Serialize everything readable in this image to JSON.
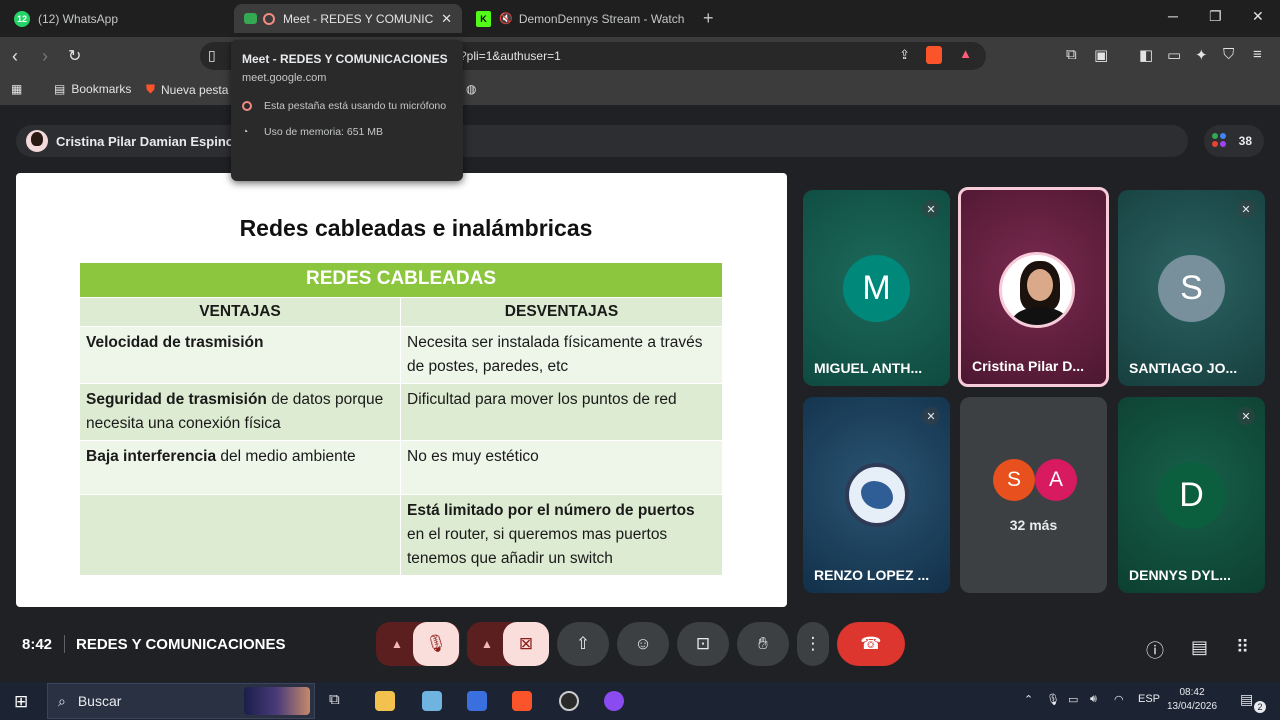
{
  "browser": {
    "tabs": [
      {
        "title": "(12) WhatsApp",
        "badge": "12"
      },
      {
        "title": "Meet - REDES Y COMUNICAC"
      },
      {
        "title": "DemonDennys Stream - Watch Li"
      }
    ],
    "new_tab_label": "+",
    "url_partial": "?pli=1&authuser=1",
    "bookmarks": [
      {
        "label": "Bookmarks"
      },
      {
        "label": "Nueva pesta"
      }
    ]
  },
  "tooltip": {
    "title": "Meet - REDES Y COMUNICACIONES",
    "domain": "meet.google.com",
    "mic_line": "Esta pestaña está usando tu micrófono",
    "memory_line": "Uso de memoria: 651 MB"
  },
  "meet": {
    "presenter_name": "Cristina Pilar Damian Espinoz",
    "people_count": "38",
    "slide": {
      "title": "Redes cableadas e inalámbricas",
      "table_title": "REDES CABLEADAS",
      "col_left": "VENTAJAS",
      "col_right": "DESVENTAJAS",
      "rows": [
        {
          "left_bold": "Velocidad de trasmisión",
          "left_rest": "",
          "right_bold": "",
          "right_rest": "Necesita ser instalada físicamente a través de postes, paredes, etc"
        },
        {
          "left_bold": "Seguridad de trasmisión",
          "left_rest": " de datos porque necesita una conexión física",
          "right_bold": "",
          "right_rest": "Dificultad para mover los puntos de red"
        },
        {
          "left_bold": "Baja interferencia",
          "left_rest": " del medio ambiente",
          "right_bold": "",
          "right_rest": "No es muy estético"
        },
        {
          "left_bold": "",
          "left_rest": "",
          "right_bold": "Está limitado por el número de puertos",
          "right_rest": " en el router, si queremos mas puertos tenemos que añadir un switch"
        }
      ]
    },
    "tiles": [
      {
        "name": "MIGUEL ANTH...",
        "initial": "M",
        "avatar_color": "#00897b",
        "bg": "#0f5147"
      },
      {
        "name": "Cristina Pilar D...",
        "bg": "#5b1c3a"
      },
      {
        "name": "SANTIAGO JO...",
        "initial": "S",
        "avatar_color": "#78909c",
        "bg": "#1d4b4a"
      },
      {
        "name": "RENZO LOPEZ ...",
        "bg": "#17384a"
      },
      {
        "more": "32 más",
        "a1": "S",
        "a1_color": "#e8501e",
        "a2": "A",
        "a2_color": "#d81b60",
        "bg": "#3c4043"
      },
      {
        "name": "DENNYS DYL...",
        "initial": "D",
        "avatar_color": "#0b5e3e",
        "bg": "#0f4a37"
      }
    ],
    "clock": "8:42",
    "meeting_title": "REDES Y COMUNICACIONES"
  },
  "taskbar": {
    "search_placeholder": "Buscar",
    "lang": "ESP",
    "time": "08:42",
    "date": "13/04/2026",
    "notif_count": "2"
  }
}
